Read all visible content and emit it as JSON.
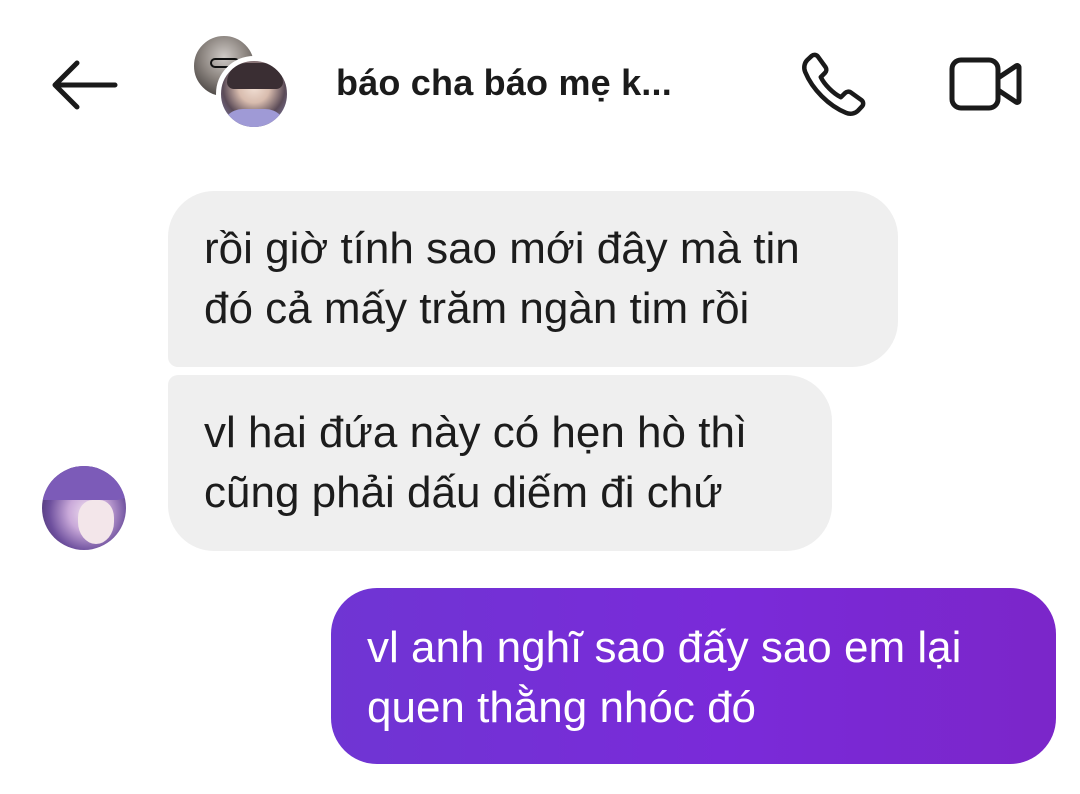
{
  "header": {
    "title": "báo cha báo mẹ k...",
    "back_icon": "arrow-left-icon",
    "call_icon": "phone-icon",
    "video_icon": "video-camera-icon"
  },
  "messages": [
    {
      "direction": "incoming",
      "text": "rồi giờ tính sao mới đây mà tin\nđó cả mấy trăm ngàn tim rồi"
    },
    {
      "direction": "incoming",
      "text": "vl hai đứa này có hẹn hò thì\ncũng phải dấu diếm đi chứ"
    },
    {
      "direction": "outgoing",
      "text": "vl anh nghĩ sao đấy sao em lại\nquen thằng nhóc đó"
    }
  ],
  "colors": {
    "incoming_bubble": "#efefef",
    "outgoing_bubble_start": "#6f35d3",
    "outgoing_bubble_end": "#7b26c9",
    "background": "#ffffff"
  }
}
